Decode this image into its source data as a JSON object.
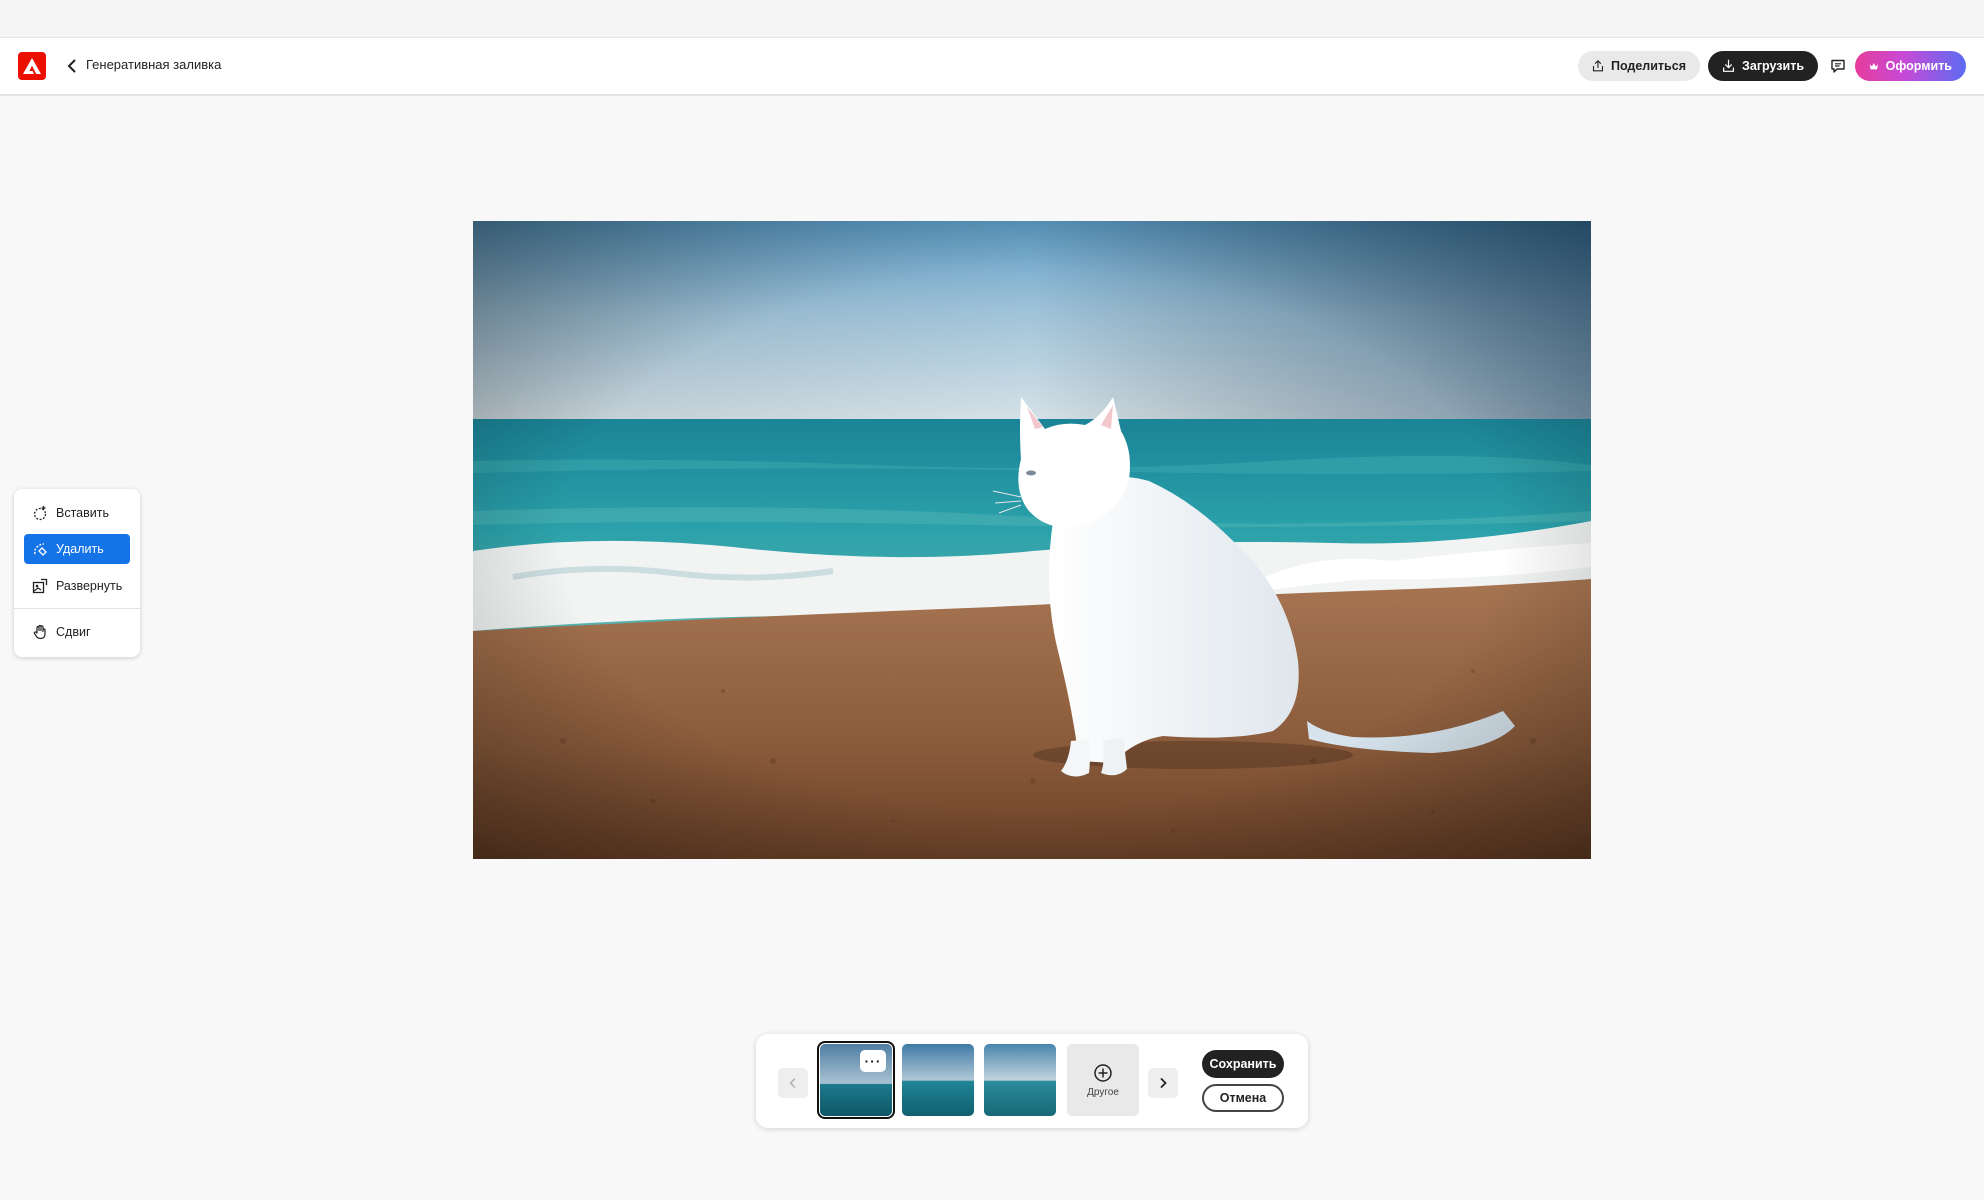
{
  "header": {
    "title": "Генеративная заливка",
    "share_label": "Поделиться",
    "download_label": "Загрузить",
    "upgrade_label": "Оформить",
    "logo_icon": "adobe-logo-icon",
    "back_icon": "chevron-left-icon",
    "comment_icon": "comment-icon"
  },
  "colors": {
    "brand": "#eb1000",
    "active_tool": "#1473e6",
    "primary_button": "#222222",
    "upgrade_gradient": [
      "#e63c9b",
      "#c64ad8",
      "#5b6cf1"
    ]
  },
  "tools": {
    "items": [
      {
        "label": "Вставить",
        "icon": "insert-icon",
        "active": false
      },
      {
        "label": "Удалить",
        "icon": "remove-icon",
        "active": true
      },
      {
        "label": "Развернуть",
        "icon": "expand-icon",
        "active": false
      },
      {
        "label": "Сдвиг",
        "icon": "hand-pan-icon",
        "active": false
      }
    ]
  },
  "variations": {
    "selected_index": 0,
    "more_label": "Другое",
    "save_label": "Сохранить",
    "cancel_label": "Отмена",
    "menu_glyph": "···"
  }
}
